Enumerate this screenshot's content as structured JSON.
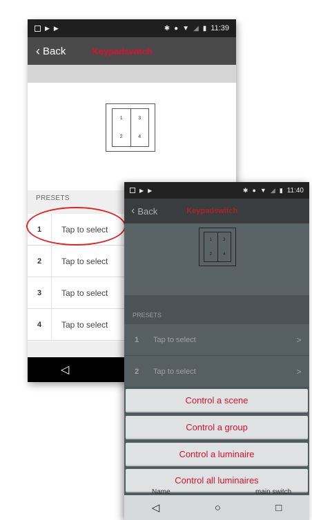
{
  "colors": {
    "accent_red": "#d6122e",
    "statusbar": "#1f1f1f",
    "appbar_dark": "#4a4a4a"
  },
  "phone1": {
    "status": {
      "time": "11:39",
      "left_icons": [
        "notification-icon",
        "play-icon",
        "play-icon"
      ],
      "right_icons": [
        "bluetooth-icon",
        "minus-circle-icon",
        "wifi-icon",
        "signal-icon",
        "battery-icon"
      ]
    },
    "appbar": {
      "back_label": "Back",
      "title": "Keypadswitch"
    },
    "panel": {
      "buttons": [
        "1",
        "2",
        "3",
        "4"
      ]
    },
    "presets_label": "PRESETS",
    "presets": [
      {
        "number": "1",
        "label": "Tap to select"
      },
      {
        "number": "2",
        "label": "Tap to select"
      },
      {
        "number": "3",
        "label": "Tap to select"
      },
      {
        "number": "4",
        "label": "Tap to select"
      }
    ],
    "nav": {
      "back_icon": "◁"
    }
  },
  "phone2": {
    "status": {
      "time": "11:40",
      "left_icons": [
        "notification-icon",
        "play-icon",
        "play-icon"
      ],
      "right_icons": [
        "bluetooth-icon",
        "minus-circle-icon",
        "wifi-icon",
        "signal-icon",
        "battery-icon"
      ]
    },
    "appbar": {
      "back_label": "Back",
      "title": "Keypadswitch"
    },
    "panel": {
      "buttons": [
        "1",
        "2",
        "3",
        "4"
      ]
    },
    "presets_label": "PRESETS",
    "presets": [
      {
        "number": "1",
        "label": "Tap to select",
        "arrow": ">"
      },
      {
        "number": "2",
        "label": "Tap to select",
        "arrow": ">"
      }
    ],
    "menu": [
      "Control a scene",
      "Control a group",
      "Control a luminaire",
      "Control all luminaires"
    ],
    "peek": {
      "left": "Name",
      "right": "main switch"
    },
    "nav": {
      "back_icon": "◁",
      "home_icon": "○",
      "recent_icon": "□"
    }
  }
}
